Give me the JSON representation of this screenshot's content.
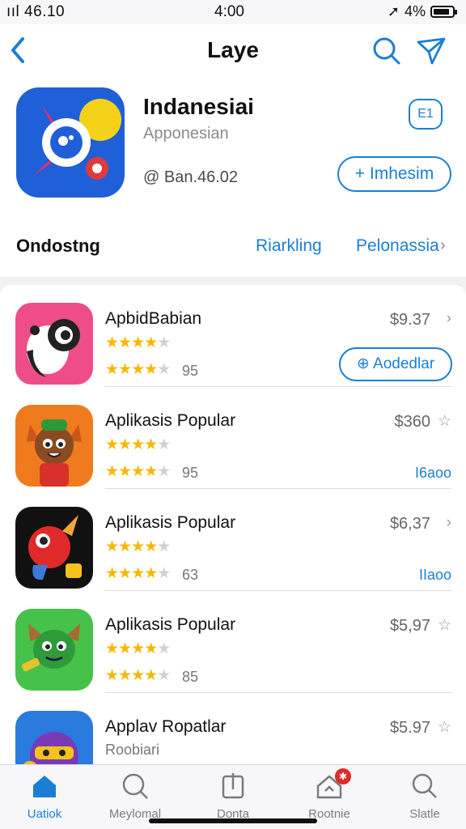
{
  "status_bar": {
    "left": "ııl 46.10",
    "time": "4:00",
    "battery": "4%"
  },
  "nav": {
    "title": "Laye"
  },
  "hero": {
    "title": "Indanesiai",
    "subtitle": "Apponesian",
    "meta": "@ Ban.46.02",
    "badge": "E1",
    "button": "+ Imhesim"
  },
  "segment": {
    "label": "Ondostng",
    "link1": "Riarkling",
    "link2": "Pelonassia"
  },
  "colors": {
    "accent": "#1a7fd4",
    "star": "#f5b800",
    "badge": "#e02a2a"
  },
  "list": [
    {
      "name": "ApbidBabian",
      "stars_top": 3.5,
      "stars_bottom": 4,
      "count": "95",
      "price": "$9.37",
      "price_icon": "chevron-right-icon",
      "button": "⊕ Aodedlar",
      "icon": "panda-icon"
    },
    {
      "name": "Aplikasis Popular",
      "stars_top": 3.5,
      "stars_bottom": 4,
      "count": "95",
      "price": "$360",
      "price_icon": "star-outline-icon",
      "link": "I6aoo",
      "icon": "cartoon-boy-icon"
    },
    {
      "name": "Aplikasis Popular",
      "stars_top": 3.5,
      "stars_bottom": 4,
      "count": "63",
      "price": "$6,37",
      "price_icon": "chevron-right-icon",
      "link": "IIaoo",
      "icon": "bird-icon"
    },
    {
      "name": "Aplikasis Popular",
      "stars_top": 3.5,
      "stars_bottom": 4,
      "count": "85",
      "price": "$5,97",
      "price_icon": "star-outline-icon",
      "icon": "green-cat-icon"
    },
    {
      "name": "Applav Ropatlar",
      "subline": "Roobiari",
      "price": "$5.97",
      "price_icon": "star-outline-icon",
      "icon": "ninja-icon"
    }
  ],
  "tabs": [
    {
      "label": "Uatiok",
      "icon": "home-icon",
      "active": true
    },
    {
      "label": "Meylomal",
      "icon": "search-icon",
      "active": false
    },
    {
      "label": "Donta",
      "icon": "apps-icon",
      "active": false
    },
    {
      "label": "Rootnie",
      "icon": "updates-icon",
      "active": false,
      "badge": "✱"
    },
    {
      "label": "Slatle",
      "icon": "search-icon",
      "active": false
    }
  ]
}
